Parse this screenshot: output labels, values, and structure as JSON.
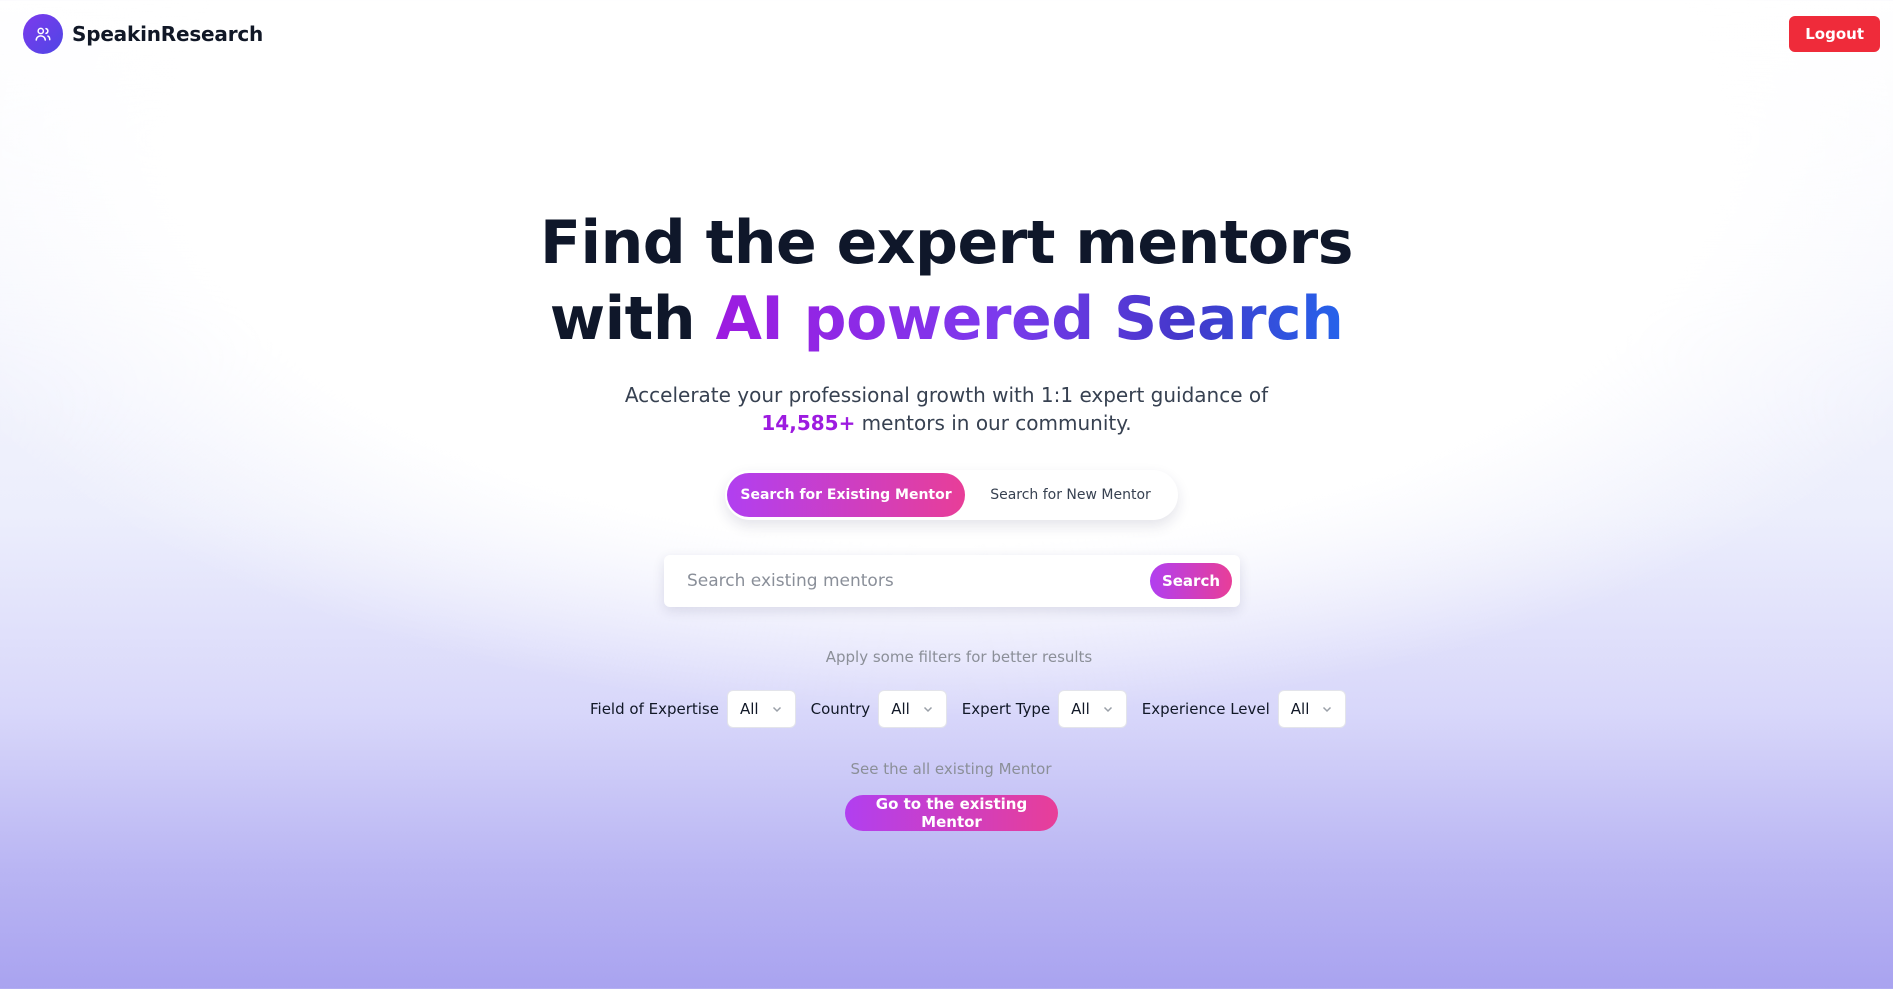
{
  "header": {
    "brand_name": "SpeakinResearch",
    "logo_icon": "users-icon",
    "logout_label": "Logout"
  },
  "hero": {
    "title_line1": "Find the expert mentors",
    "title_line2_prefix": "with ",
    "title_line2_highlight": "AI powered Search",
    "subtitle_line1": "Accelerate your professional growth with 1:1 expert guidance of",
    "mentor_count": "14,585+",
    "subtitle_line2_suffix": " mentors in our community."
  },
  "toggle": {
    "active_label": "Search for Existing Mentor",
    "inactive_label": "Search for New Mentor"
  },
  "search": {
    "placeholder": "Search existing mentors",
    "value": "",
    "button_label": "Search"
  },
  "filters": {
    "hint": "Apply some filters for better results",
    "items": [
      {
        "label": "Field of Expertise",
        "value": "All"
      },
      {
        "label": "Country",
        "value": "All"
      },
      {
        "label": "Expert Type",
        "value": "All"
      },
      {
        "label": "Experience Level",
        "value": "All"
      }
    ]
  },
  "existing": {
    "hint": "See the all existing Mentor",
    "button_label": "Go to the existing Mentor"
  },
  "colors": {
    "accent_purple": "#9d1be0",
    "accent_pink": "#e83e98",
    "logout_red": "#ef2b3a",
    "logo_indigo": "#4f46e5"
  }
}
